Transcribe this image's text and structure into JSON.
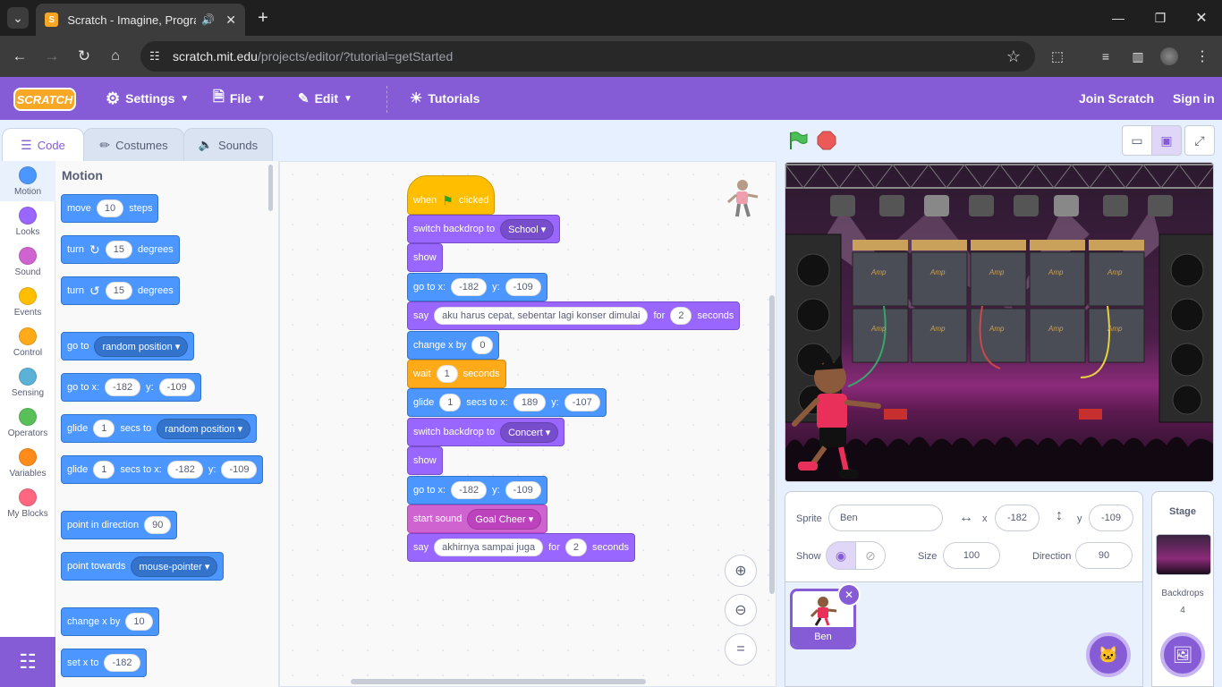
{
  "browser": {
    "tab_title": "Scratch - Imagine, Program,",
    "url_host": "scratch.mit.edu",
    "url_path": "/projects/editor/?tutorial=getStarted"
  },
  "menubar": {
    "logo": "SCRATCH",
    "settings": "Settings",
    "file": "File",
    "edit": "Edit",
    "tutorials": "Tutorials",
    "join": "Join Scratch",
    "signin": "Sign in"
  },
  "tabs": {
    "code": "Code",
    "costumes": "Costumes",
    "sounds": "Sounds"
  },
  "categories": [
    {
      "label": "Motion",
      "color": "#4c97ff"
    },
    {
      "label": "Looks",
      "color": "#9966ff"
    },
    {
      "label": "Sound",
      "color": "#cf63cf"
    },
    {
      "label": "Events",
      "color": "#ffbf00"
    },
    {
      "label": "Control",
      "color": "#ffab19"
    },
    {
      "label": "Sensing",
      "color": "#5cb1d6"
    },
    {
      "label": "Operators",
      "color": "#59c059"
    },
    {
      "label": "Variables",
      "color": "#ff8c1a"
    },
    {
      "label": "My Blocks",
      "color": "#ff6680"
    }
  ],
  "palette": {
    "title": "Motion",
    "move": {
      "a": "move",
      "v": "10",
      "b": "steps"
    },
    "turn_r": {
      "a": "turn",
      "v": "15",
      "b": "degrees"
    },
    "turn_l": {
      "a": "turn",
      "v": "15",
      "b": "degrees"
    },
    "goto": {
      "a": "go to",
      "dd": "random position"
    },
    "gotoxy": {
      "a": "go to x:",
      "x": "-182",
      "b": "y:",
      "y": "-109"
    },
    "glide_rand": {
      "a": "glide",
      "v": "1",
      "b": "secs to",
      "dd": "random position"
    },
    "glide_xy": {
      "a": "glide",
      "v": "1",
      "b": "secs to x:",
      "x": "-182",
      "c": "y:",
      "y": "-109"
    },
    "point_dir": {
      "a": "point in direction",
      "v": "90"
    },
    "point_tow": {
      "a": "point towards",
      "dd": "mouse-pointer"
    },
    "change_x": {
      "a": "change x by",
      "v": "10"
    },
    "set_x": {
      "a": "set x to",
      "v": "-182"
    }
  },
  "script": {
    "hat": {
      "a": "when",
      "b": "clicked"
    },
    "b1": {
      "a": "switch backdrop to",
      "dd": "School"
    },
    "b2": {
      "a": "show"
    },
    "b3": {
      "a": "go to x:",
      "x": "-182",
      "b": "y:",
      "y": "-109"
    },
    "b4": {
      "a": "say",
      "text": "aku harus cepat, sebentar lagi konser dimulai",
      "b": "for",
      "v": "2",
      "c": "seconds"
    },
    "b5": {
      "a": "change x by",
      "v": "0"
    },
    "b6": {
      "a": "wait",
      "v": "1",
      "b": "seconds"
    },
    "b7": {
      "a": "glide",
      "v": "1",
      "b": "secs to x:",
      "x": "189",
      "c": "y:",
      "y": "-107"
    },
    "b8": {
      "a": "switch backdrop to",
      "dd": "Concert"
    },
    "b9": {
      "a": "show"
    },
    "b10": {
      "a": "go to x:",
      "x": "-182",
      "b": "y:",
      "y": "-109"
    },
    "b11": {
      "a": "start sound",
      "dd": "Goal Cheer"
    },
    "b12": {
      "a": "say",
      "text": "akhirnya sampai juga",
      "b": "for",
      "v": "2",
      "c": "seconds"
    }
  },
  "sprite_info": {
    "sprite_label": "Sprite",
    "sprite_name": "Ben",
    "x_label": "x",
    "x": "-182",
    "y_label": "y",
    "y": "-109",
    "show_label": "Show",
    "size_label": "Size",
    "size": "100",
    "direction_label": "Direction",
    "direction": "90"
  },
  "sprite_tile": {
    "name": "Ben"
  },
  "stage_pane": {
    "title": "Stage",
    "backdrops_label": "Backdrops",
    "backdrops_count": "4"
  },
  "stage_scene": {
    "amp_label": "Amp"
  }
}
